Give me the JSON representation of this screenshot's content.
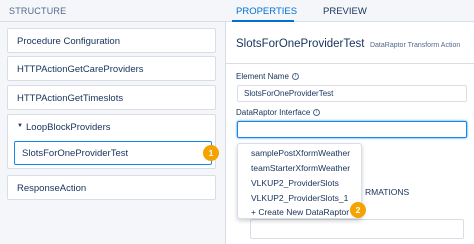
{
  "structure": {
    "header": "STRUCTURE",
    "items": [
      {
        "label": "Procedure Configuration"
      },
      {
        "label": "HTTPActionGetCareProviders"
      },
      {
        "label": "HTTPActionGetTimeslots"
      }
    ],
    "group": {
      "label": "LoopBlockProviders",
      "child": "SlotsForOneProviderTest",
      "child_badge": "1"
    },
    "last_item": "ResponseAction"
  },
  "tabs": {
    "properties": "PROPERTIES",
    "preview": "PREVIEW"
  },
  "properties": {
    "title": "SlotsForOneProviderTest",
    "subtitle": "DataRaptor Transform Action",
    "element_name_label": "Element Name",
    "element_name_value": "SlotsForOneProviderTest",
    "interface_label": "DataRaptor Interface",
    "interface_value": "",
    "info_glyph": "i",
    "obscured_heading": "RMATIONS"
  },
  "dropdown": {
    "options": [
      "samplePostXformWeather",
      "teamStarterXformWeather",
      "VLKUP2_ProviderSlots",
      "VLKUP2_ProviderSlots_1",
      "+ Create New DataRaptor"
    ],
    "create_badge": "2"
  },
  "colors": {
    "accent": "#0070d2",
    "focus_border": "#1589ee",
    "badge": "#f4a300",
    "text": "#16325c",
    "muted": "#54698d"
  }
}
